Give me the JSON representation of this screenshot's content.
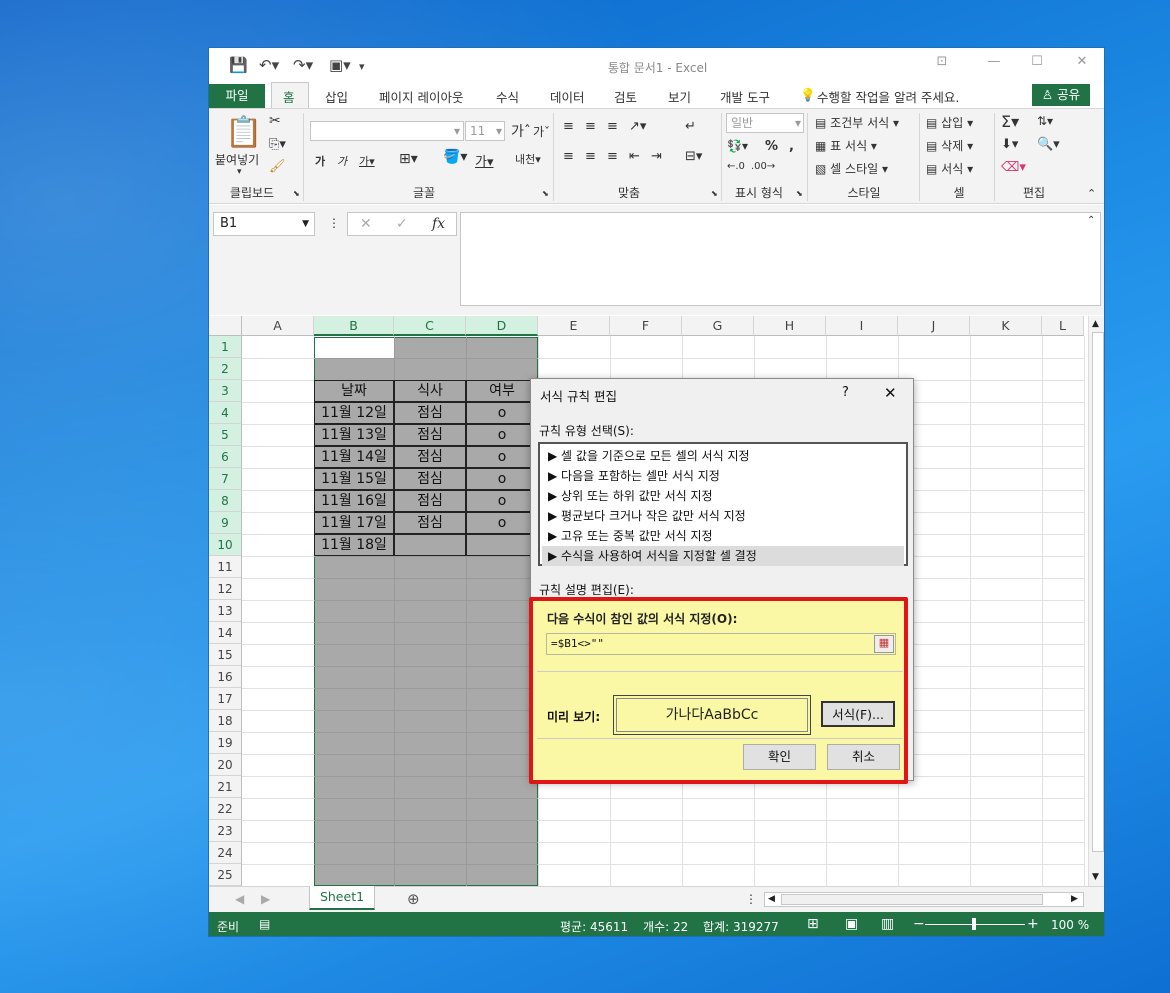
{
  "window": {
    "title": "통합 문서1 - Excel",
    "share_label": "공유",
    "tell_me": "수행할 작업을 알려 주세요."
  },
  "tabs": [
    "파일",
    "홈",
    "삽입",
    "페이지 레이아웃",
    "수식",
    "데이터",
    "검토",
    "보기",
    "개발 도구"
  ],
  "ribbon": {
    "groups": [
      "클립보드",
      "글꼴",
      "맞춤",
      "표시 형식",
      "스타일",
      "셀",
      "편집"
    ],
    "paste_label": "붙여넣기",
    "font_size": "11",
    "number_format": "일반",
    "styles": [
      "조건부 서식",
      "표 서식",
      "셀 스타일"
    ],
    "cells": [
      "삽입",
      "삭제",
      "서식"
    ]
  },
  "formula_bar": {
    "name_box": "B1",
    "fx": "fx",
    "value": ""
  },
  "columns": [
    "A",
    "B",
    "C",
    "D",
    "E",
    "F",
    "G",
    "H",
    "I",
    "J",
    "K",
    "L"
  ],
  "rows": [
    "1",
    "2",
    "3",
    "4",
    "5",
    "6",
    "7",
    "8",
    "9",
    "10",
    "11",
    "12",
    "13",
    "14",
    "15",
    "16",
    "17",
    "18",
    "19",
    "20",
    "21",
    "22",
    "23",
    "24",
    "25"
  ],
  "table": {
    "headers": [
      "날짜",
      "식사",
      "여부"
    ],
    "rows": [
      [
        "11월 12일",
        "점심",
        "o"
      ],
      [
        "11월 13일",
        "점심",
        "o"
      ],
      [
        "11월 14일",
        "점심",
        "o"
      ],
      [
        "11월 15일",
        "점심",
        "o"
      ],
      [
        "11월 16일",
        "점심",
        "o"
      ],
      [
        "11월 17일",
        "점심",
        "o"
      ],
      [
        "11월 18일",
        "",
        ""
      ]
    ]
  },
  "sheet_tab": "Sheet1",
  "status": {
    "ready": "준비",
    "average": "평균: 45611",
    "count": "개수: 22",
    "sum": "합계: 319277",
    "zoom": "100 %"
  },
  "dialog": {
    "title": "서식 규칙 편집",
    "help": "?",
    "close": "✕",
    "rule_type_label": "규칙 유형 선택(S):",
    "rule_types": [
      "▶ 셀 값을 기준으로 모든 셀의 서식 지정",
      "▶ 다음을 포함하는 셀만 서식 지정",
      "▶ 상위 또는 하위 값만 서식 지정",
      "▶ 평균보다 크거나 작은 값만 서식 지정",
      "▶ 고유 또는 중복 값만 서식 지정",
      "▶ 수식을 사용하여 서식을 지정할 셀 결정"
    ],
    "desc_label": "규칙 설명 편집(E):",
    "formula_label": "다음 수식이 참인 값의 서식 지정(O):",
    "formula_value": "=$B1<>\"\"",
    "preview_label": "미리 보기:",
    "preview_text": "가나다AaBbCc",
    "format_button": "서식(F)...",
    "ok_button": "확인",
    "cancel_button": "취소"
  }
}
